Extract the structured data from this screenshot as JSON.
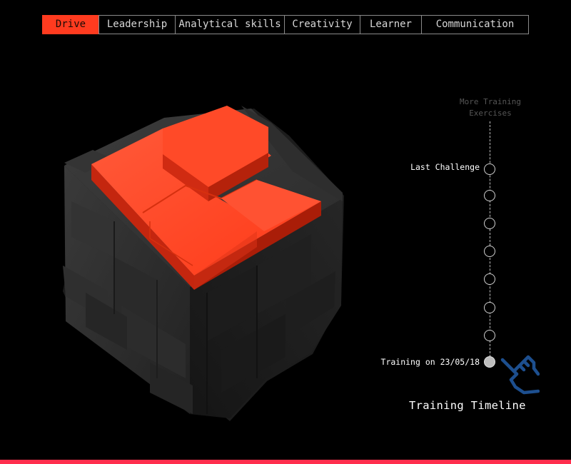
{
  "tabs": [
    {
      "label": "Drive",
      "active": true
    },
    {
      "label": "Leadership",
      "active": false
    },
    {
      "label": "Analytical skills",
      "active": false
    },
    {
      "label": "Creativity",
      "active": false
    },
    {
      "label": "Learner",
      "active": false
    },
    {
      "label": "Communication",
      "active": false
    }
  ],
  "timeline": {
    "more_label": "More Training Exercises",
    "last_label": "Last Challenge",
    "first_label": "Training on 23/05/18",
    "title": "Training Timeline",
    "node_count": 8,
    "selected_node": "Training on 23/05/18"
  },
  "colors": {
    "accent": "#ff3b1f",
    "bottom_bar": "#ff2e4d",
    "hand_icon": "#1d4f8f"
  },
  "icons": {
    "hand": "pointing-hand-icon"
  }
}
